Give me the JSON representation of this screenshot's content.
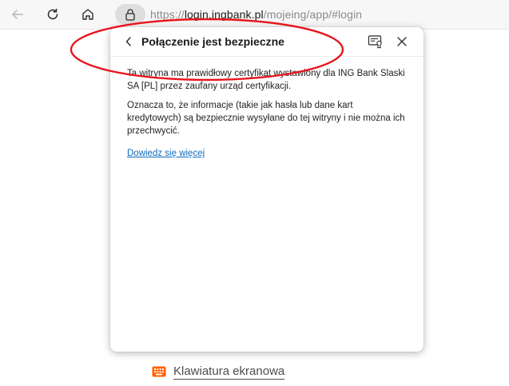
{
  "browser": {
    "url_scheme": "https://",
    "url_host": "login.ingbank.pl",
    "url_path": "/mojeing/app/#login"
  },
  "popup": {
    "title": "Połączenie jest bezpieczne",
    "paragraph1": "Ta witryna ma prawidłowy certyfikat wystawiony dla ING Bank Slaski SA [PL] przez zaufany urząd certyfikacji.",
    "paragraph2": "Oznacza to, że informacje (takie jak hasła lub dane kart kredytowych) są bezpiecznie wysyłane do tej witryny i nie można ich przechwycić.",
    "learn_more": "Dowiedz się więcej"
  },
  "page": {
    "keyboard_label": "Klawiatura ekranowa"
  },
  "icons": {
    "back": "arrow-left-icon",
    "refresh": "refresh-icon",
    "home": "home-icon",
    "lock": "lock-icon",
    "popup_back": "chevron-left-icon",
    "certificate": "certificate-icon",
    "close": "close-icon",
    "keyboard": "keyboard-icon"
  },
  "colors": {
    "annotation": "#e8141c",
    "link": "#0f6cbd",
    "keyboard_icon": "#ff6200"
  }
}
